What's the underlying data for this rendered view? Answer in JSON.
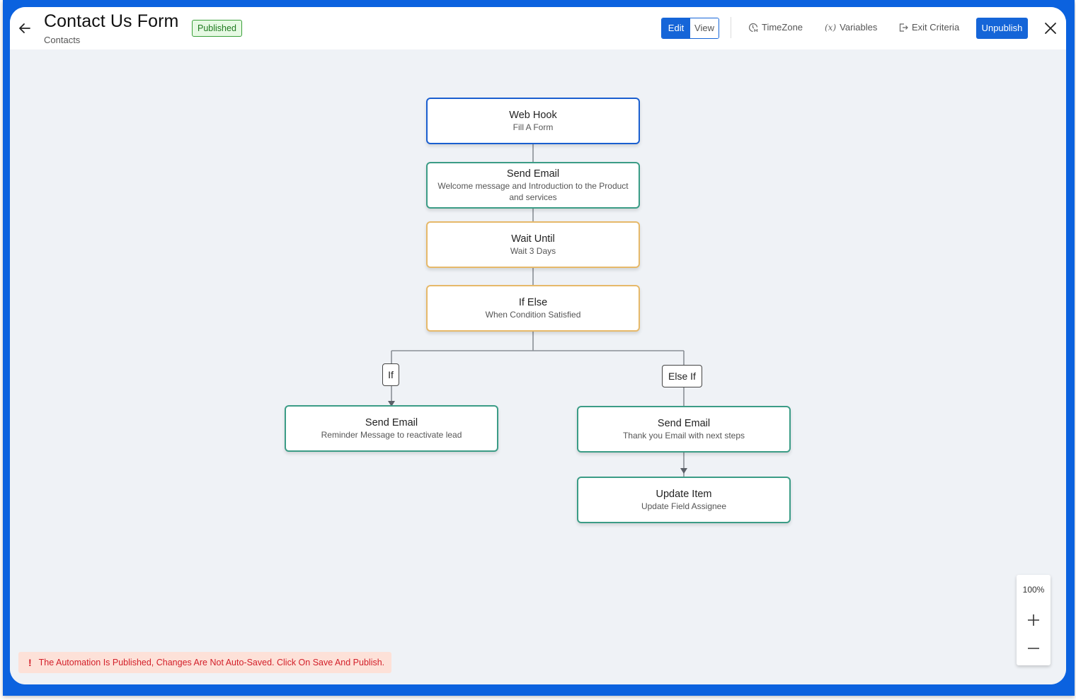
{
  "header": {
    "title": "Contact Us Form",
    "subtitle": "Contacts",
    "status_badge": "Published",
    "mode_toggle": {
      "edit_label": "Edit",
      "view_label": "View",
      "active": "Edit"
    },
    "tools": {
      "timezone_label": "TimeZone",
      "variables_label": "Variables",
      "variables_glyph": "(x)",
      "exit_criteria_label": "Exit Criteria"
    },
    "unpublish_label": "Unpublish"
  },
  "flow": {
    "nodes": [
      {
        "id": "webhook",
        "type": "trigger",
        "title": "Web Hook",
        "subtitle": "Fill A Form"
      },
      {
        "id": "send-email-welcome",
        "type": "action",
        "title": "Send Email",
        "subtitle": "Welcome message and Introduction to the Product and services"
      },
      {
        "id": "wait-until",
        "type": "control",
        "title": "Wait Until",
        "subtitle": "Wait 3 Days"
      },
      {
        "id": "if-else",
        "type": "control",
        "title": "If Else",
        "subtitle": "When Condition Satisfied"
      },
      {
        "id": "send-email-reminder",
        "type": "action",
        "title": "Send Email",
        "subtitle": "Reminder Message to reactivate lead"
      },
      {
        "id": "send-email-thankyou",
        "type": "action",
        "title": "Send Email",
        "subtitle": "Thank you Email with next steps"
      },
      {
        "id": "update-item",
        "type": "action",
        "title": "Update Item",
        "subtitle": "Update Field Assignee"
      }
    ],
    "branches": {
      "if_label": "If",
      "else_if_label": "Else If"
    }
  },
  "zoom": {
    "level": "100%"
  },
  "warning": {
    "icon": "!",
    "message": "The Automation Is Published, Changes Are Not Auto-Saved. Click On Save And Publish."
  },
  "colors": {
    "brand": "#0b62df",
    "primary_button": "#1565d8",
    "trigger_border": "#1a5fd0",
    "action_border": "#3b9c86",
    "control_border": "#e6b96a",
    "warning_text": "#d3202a",
    "warning_bg": "#fde1d8",
    "badge_bg": "#e6f9e3",
    "badge_border": "#3aa03a"
  }
}
